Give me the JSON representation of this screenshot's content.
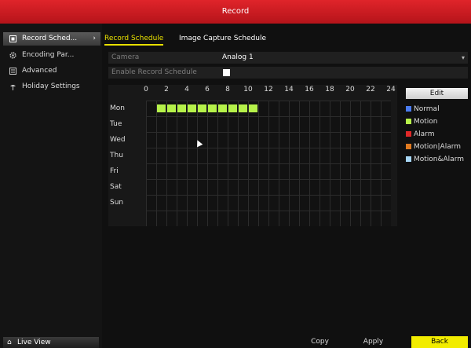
{
  "window": {
    "title": "Record"
  },
  "sidebar": {
    "items": [
      {
        "label": "Record Sched...",
        "icon": "record-schedule-icon",
        "active": true
      },
      {
        "label": "Encoding Par...",
        "icon": "gear-icon",
        "active": false
      },
      {
        "label": "Advanced",
        "icon": "advanced-settings-icon",
        "active": false
      },
      {
        "label": "Holiday Settings",
        "icon": "holiday-icon",
        "active": false
      }
    ],
    "live_view": "Live View"
  },
  "tabs": [
    {
      "label": "Record Schedule",
      "active": true
    },
    {
      "label": "Image Capture Schedule",
      "active": false
    }
  ],
  "camera": {
    "label": "Camera",
    "value": "Analog 1"
  },
  "enable": {
    "label": "Enable Record Schedule",
    "checked": true
  },
  "schedule": {
    "hours": [
      "0",
      "2",
      "4",
      "6",
      "8",
      "10",
      "12",
      "14",
      "16",
      "18",
      "20",
      "22",
      "24"
    ],
    "days": [
      "Mon",
      "Tue",
      "Wed",
      "Thu",
      "Fri",
      "Sat",
      "Sun"
    ],
    "filled": {
      "Mon": [
        1,
        2,
        3,
        4,
        5,
        6,
        7,
        8,
        9,
        10
      ]
    }
  },
  "edit_label": "Edit",
  "legend": [
    {
      "label": "Normal",
      "color": "#4a7cf0"
    },
    {
      "label": "Motion",
      "color": "#b6f24a"
    },
    {
      "label": "Alarm",
      "color": "#e02828"
    },
    {
      "label": "Motion|Alarm",
      "color": "#e07a20"
    },
    {
      "label": "Motion&Alarm",
      "color": "#a8d8f8"
    }
  ],
  "buttons": {
    "copy": "Copy",
    "apply": "Apply",
    "back": "Back"
  }
}
